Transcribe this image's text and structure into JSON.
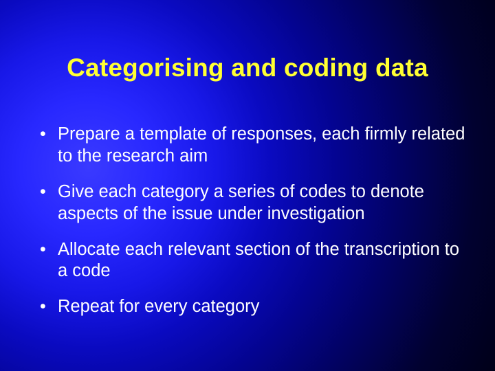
{
  "title": "Categorising and coding data",
  "bullets": [
    "Prepare a template of responses, each firmly related to the research aim",
    "Give each category a series of codes to denote aspects of the issue under investigation",
    "Allocate each relevant section of the transcription to a code",
    "Repeat for every category"
  ]
}
